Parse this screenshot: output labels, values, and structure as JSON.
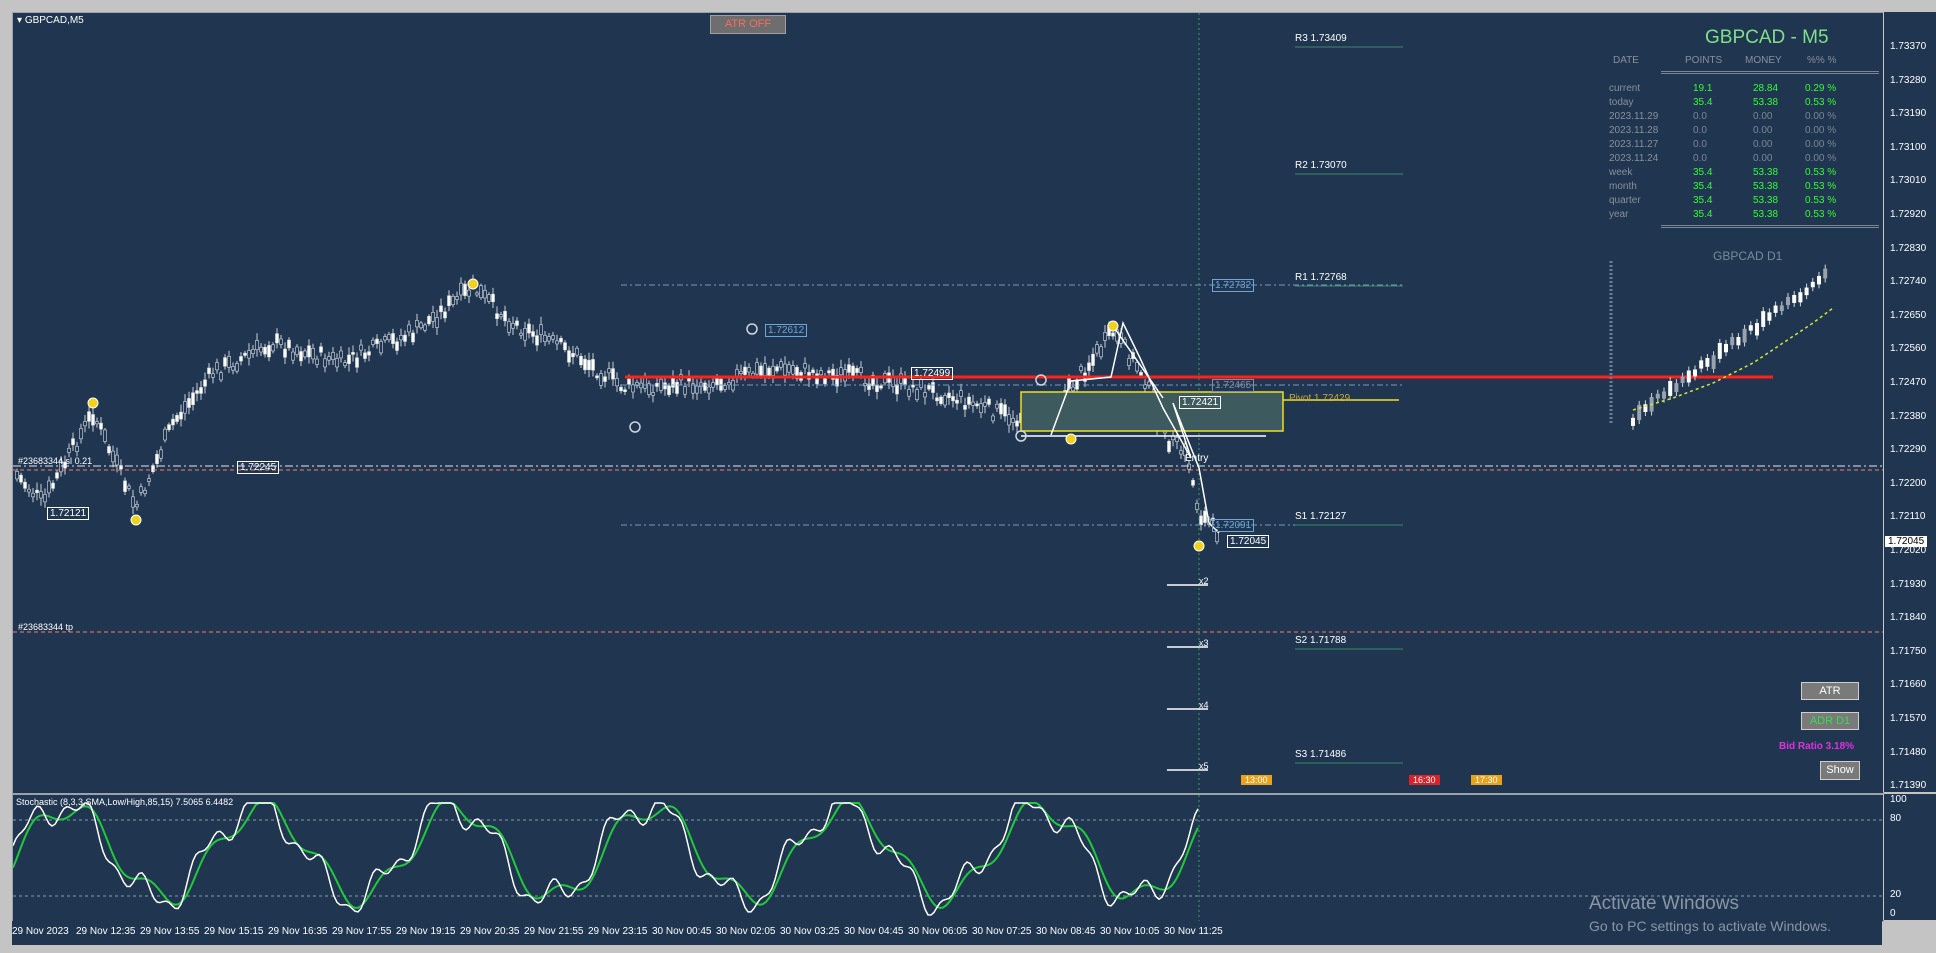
{
  "chart": {
    "symbol_title": "GBPCAD,M5",
    "atr_off_label": "ATR OFF",
    "d1_label": "GBPCAD  D1",
    "pivots": [
      {
        "label": "R3 1.73409",
        "price": 1.73409
      },
      {
        "label": "R2 1.73070",
        "price": 1.7307
      },
      {
        "label": "R1 1.72768",
        "price": 1.72768
      },
      {
        "label": "S1 1.72127",
        "price": 1.72127
      },
      {
        "label": "S2 1.71788",
        "price": 1.71788
      },
      {
        "label": "S3 1.71486",
        "price": 1.71486
      }
    ],
    "pivot_label": "Pivot 1.72429",
    "price_tags": [
      "1.72732",
      "1.72612",
      "1.72499",
      "1.72465",
      "1.72421",
      "1.72245",
      "1.72121",
      "1.72091",
      "1.72045"
    ],
    "entry_label": "Entry",
    "multipliers": [
      "x2",
      "x3",
      "x4",
      "x5"
    ],
    "order_labels": [
      "#23683344 sl",
      "#23683344 tp"
    ],
    "order_value": "0.21",
    "event_tags": [
      "13:00",
      "16:30",
      "17:30"
    ]
  },
  "price_axis": {
    "labels": [
      "1.73370",
      "1.73280",
      "1.73190",
      "1.73100",
      "1.73010",
      "1.72920",
      "1.72830",
      "1.72740",
      "1.72650",
      "1.72560",
      "1.72470",
      "1.72380",
      "1.72290",
      "1.72200",
      "1.72110",
      "1.72020",
      "1.71930",
      "1.71840",
      "1.71750",
      "1.71660",
      "1.71570",
      "1.71480",
      "1.71390"
    ],
    "current": "1.72045"
  },
  "stats_panel": {
    "title": "GBPCAD - M5",
    "headers": [
      "DATE",
      "POINTS",
      "MONEY",
      "%%  %"
    ],
    "rows": [
      {
        "label": "current",
        "points": "19.1",
        "money": "28.84",
        "pct": "0.29  %",
        "tone": "green"
      },
      {
        "label": "today",
        "points": "35.4",
        "money": "53.38",
        "pct": "0.53  %",
        "tone": "green"
      },
      {
        "label": "2023.11.29",
        "points": "0.0",
        "money": "0.00",
        "pct": "0.00  %",
        "tone": "gray"
      },
      {
        "label": "2023.11.28",
        "points": "0.0",
        "money": "0.00",
        "pct": "0.00  %",
        "tone": "gray"
      },
      {
        "label": "2023.11.27",
        "points": "0.0",
        "money": "0.00",
        "pct": "0.00  %",
        "tone": "gray"
      },
      {
        "label": "2023.11.24",
        "points": "0.0",
        "money": "0.00",
        "pct": "0.00  %",
        "tone": "gray"
      },
      {
        "label": "week",
        "points": "35.4",
        "money": "53.38",
        "pct": "0.53  %",
        "tone": "green"
      },
      {
        "label": "month",
        "points": "35.4",
        "money": "53.38",
        "pct": "0.53  %",
        "tone": "green"
      },
      {
        "label": "quarter",
        "points": "35.4",
        "money": "53.38",
        "pct": "0.53  %",
        "tone": "green"
      },
      {
        "label": "year",
        "points": "35.4",
        "money": "53.38",
        "pct": "0.53  %",
        "tone": "green"
      }
    ]
  },
  "buttons": {
    "atr": "ATR",
    "adr": "ADR D1",
    "show": "Show"
  },
  "bid_ratio": "Bid Ratio 3.18%",
  "stochastic": {
    "title": "Stochastic (8,3,3,SMA,Low/High,85,15) 7.5065 6.4482",
    "levels": [
      "100",
      "80",
      "20",
      "0"
    ]
  },
  "time_axis": [
    "29 Nov 2023",
    "29 Nov 12:35",
    "29 Nov 13:55",
    "29 Nov 15:15",
    "29 Nov 16:35",
    "29 Nov 17:55",
    "29 Nov 19:15",
    "29 Nov 20:35",
    "29 Nov 21:55",
    "29 Nov 23:15",
    "30 Nov 00:45",
    "30 Nov 02:05",
    "30 Nov 03:25",
    "30 Nov 04:45",
    "30 Nov 06:05",
    "30 Nov 07:25",
    "30 Nov 08:45",
    "30 Nov 10:05",
    "30 Nov 11:25"
  ],
  "watermark": {
    "line1": "Activate Windows",
    "line2": "Go to PC settings to activate Windows."
  },
  "colors": {
    "background": "#1f3550",
    "resistance_line": "#ff2020",
    "stochastic_main": "#ffffff",
    "stochastic_signal": "#21c93a",
    "panel_green": "#33ff33"
  }
}
